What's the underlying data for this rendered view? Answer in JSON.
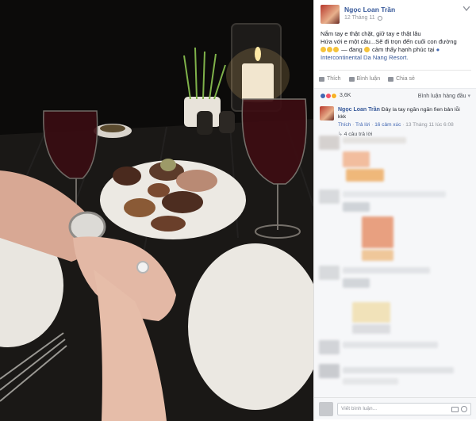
{
  "post": {
    "author": "Ngọc Loan Trần",
    "date": "12 Tháng 11",
    "text_line1": "Nắm tay e thật chặt, giữ tay e thật lâu",
    "text_line2": "Hứa với e một câu...Sẽ đi trọn đến cuối con đường",
    "text_line3_suffix": "— đang",
    "feeling": "cảm thấy hạnh phúc tại",
    "location": "Intercontinental Da Nang Resort."
  },
  "actions": {
    "like": "Thích",
    "comment": "Bình luận",
    "share": "Chia sẻ"
  },
  "reactions": {
    "count": "3,6K",
    "sort_label": "Bình luận hàng đầu"
  },
  "comment": {
    "author": "Ngọc Loan Trần",
    "text_line1": "Đây la tay ngăn ngăn fien bản lỗi",
    "text_line2": "kkk",
    "like": "Thích",
    "reply": "Trả lời",
    "reactions": "16 cảm xúc",
    "time": "13 Tháng 11 lúc 6:08",
    "replies": "4 câu trả lời"
  },
  "compose": {
    "placeholder": "Viết bình luận..."
  },
  "colors": {
    "link": "#365899",
    "fb_blue": "#4267b2",
    "sidebar_bg": "#ffffff",
    "comment_bg": "#f6f7f9"
  },
  "icons": [
    "globe-icon",
    "chevron-down-icon",
    "like-icon",
    "comment-icon",
    "share-icon",
    "camera-icon",
    "emoji-icon",
    "location-pin-icon"
  ]
}
